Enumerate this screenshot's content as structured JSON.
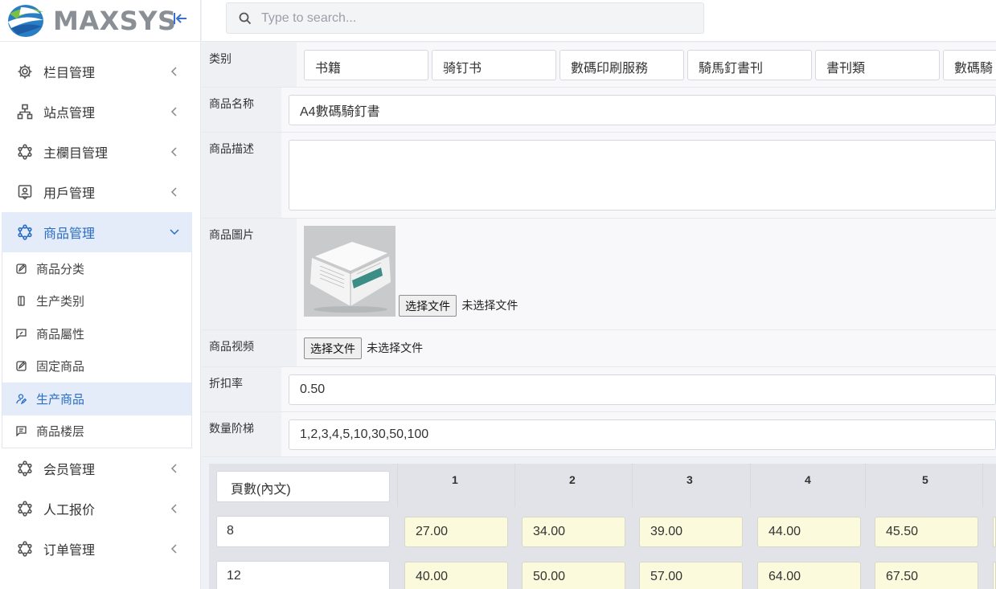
{
  "brand": {
    "name": "MAXSYS"
  },
  "search": {
    "placeholder": "Type to search..."
  },
  "sidebar": {
    "items": [
      {
        "label": "栏目管理"
      },
      {
        "label": "站点管理"
      },
      {
        "label": "主欄目管理"
      },
      {
        "label": "用戶管理"
      },
      {
        "label": "商品管理"
      },
      {
        "label": "会员管理"
      },
      {
        "label": "人工报价"
      },
      {
        "label": "订单管理"
      }
    ],
    "submenu": [
      {
        "label": "商品分类"
      },
      {
        "label": "生产类别"
      },
      {
        "label": "商品屬性"
      },
      {
        "label": "固定商品"
      },
      {
        "label": "生产商品"
      },
      {
        "label": "商品楼层"
      }
    ]
  },
  "form": {
    "category_label": "类别",
    "categories": [
      "书籍",
      "骑钉书",
      "數碼印刷服務",
      "騎馬釘書刊",
      "書刊類",
      "數碼騎"
    ],
    "name_label": "商品名称",
    "name_value": "A4數碼騎釘書",
    "desc_label": "商品描述",
    "desc_value": "",
    "image_label": "商品圖片",
    "video_label": "商品视频",
    "file_button": "选择文件",
    "file_status": "未选择文件",
    "discount_label": "折扣率",
    "discount_value": "0.50",
    "qty_label": "数量阶梯",
    "qty_value": "1,2,3,4,5,10,30,50,100"
  },
  "price_grid": {
    "header_label": "頁數(內文)",
    "columns": [
      "1",
      "2",
      "3",
      "4",
      "5"
    ],
    "rows": [
      {
        "pages": "8",
        "prices": [
          "27.00",
          "34.00",
          "39.00",
          "44.00",
          "45.50"
        ]
      },
      {
        "pages": "12",
        "prices": [
          "40.00",
          "50.00",
          "57.00",
          "64.00",
          "67.50"
        ]
      }
    ]
  },
  "colors": {
    "accent": "#2b6cc4",
    "active_bg": "#e3ecf8",
    "price_bg": "#fbfadc"
  }
}
